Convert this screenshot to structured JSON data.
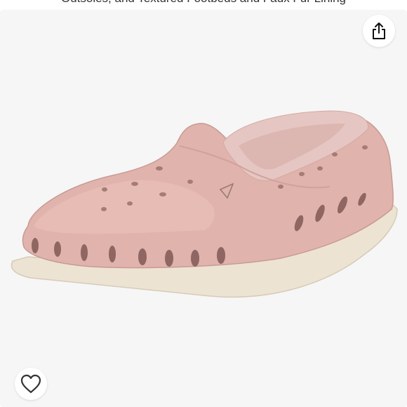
{
  "listing": {
    "title_partial": "Outsoles, and Textured Footbeds and Faux Fur Lining"
  },
  "product": {
    "color_name": "rose pink",
    "color": "#e0b3ac",
    "sole_color": "#ece3d3",
    "lining_color": "#e6c6c2"
  },
  "actions": {
    "share_icon": "share-icon",
    "favorite_icon": "heart-outline-icon"
  }
}
